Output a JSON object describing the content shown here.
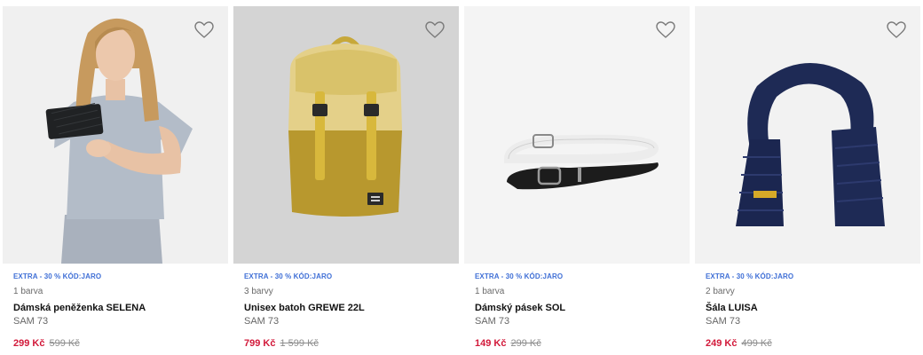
{
  "colors": {
    "promo": "#3f6fd6",
    "price": "#d2193a",
    "card_bg_1": "#f0f0f0",
    "card_bg_2": "#d4d4d4",
    "card_bg_3": "#f4f4f4",
    "card_bg_4": "#f2f2f2"
  },
  "products": [
    {
      "promo": "EXTRA - 30 % KÓD:JARO",
      "colors_count": "1 barva",
      "name": "Dámská peněženka SELENA",
      "brand": "SAM 73",
      "price": "299 Kč",
      "old_price": "599 Kč",
      "image": "woman-with-wallet",
      "favorite_icon": "heart-outline-icon"
    },
    {
      "promo": "EXTRA - 30 % KÓD:JARO",
      "colors_count": "3 barvy",
      "name": "Unisex batoh GREWE 22L",
      "brand": "SAM 73",
      "price": "799 Kč",
      "old_price": "1 599 Kč",
      "image": "backpack",
      "favorite_icon": "heart-outline-icon"
    },
    {
      "promo": "EXTRA - 30 % KÓD:JARO",
      "colors_count": "1 barva",
      "name": "Dámský pásek SOL",
      "brand": "SAM 73",
      "price": "149 Kč",
      "old_price": "299 Kč",
      "image": "belts",
      "favorite_icon": "heart-outline-icon"
    },
    {
      "promo": "EXTRA - 30 % KÓD:JARO",
      "colors_count": "2 barvy",
      "name": "Šála LUISA",
      "brand": "SAM 73",
      "price": "249 Kč",
      "old_price": "499 Kč",
      "image": "scarf",
      "favorite_icon": "heart-outline-icon"
    }
  ]
}
